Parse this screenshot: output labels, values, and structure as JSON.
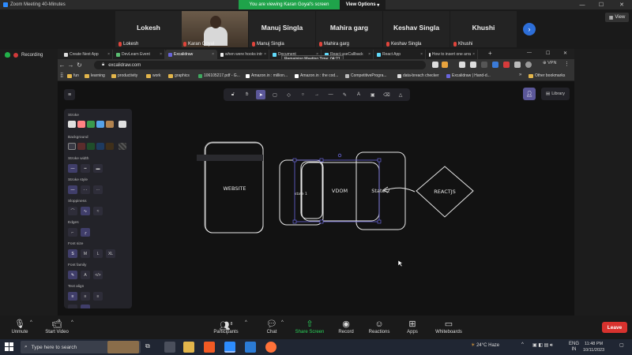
{
  "window": {
    "title": "Zoom Meeting 40-Minutes"
  },
  "share_banner": {
    "message": "You are viewing Karan Goyal's screen",
    "options_label": "View Options"
  },
  "participants": [
    {
      "name": "Lokesh",
      "foot": "Lokesh"
    },
    {
      "name": "Karan Goyal",
      "foot": "Karan Goyal",
      "video": true
    },
    {
      "name": "Manuj Singla",
      "foot": "Manuj Singla"
    },
    {
      "name": "Mahira garg",
      "foot": "Mahira garg"
    },
    {
      "name": "Keshav Singla",
      "foot": "Keshav Singla"
    },
    {
      "name": "Khushi",
      "foot": "Khushi"
    }
  ],
  "view_label": "View",
  "recording_label": "Recording",
  "browser": {
    "tabs": [
      "Create Next App",
      "DevLearn Event",
      "Excalidraw",
      "when were hooks intr",
      "Document",
      "React.useCallback",
      "React App",
      "How to insert one arra"
    ],
    "tooltip": "Remaining Meeting Time: 04:21",
    "url": "excalidraw.com",
    "vpn": "VPN",
    "bookmarks": [
      "fun",
      "learning",
      "productivity",
      "work",
      "graphics",
      "106105217.pdf - G...",
      "Amazon.in : million...",
      "Amazon.in : the cod...",
      "CompetitiveProgra...",
      "data-breach checker",
      "Excalidraw | Hand-d..."
    ],
    "other_bookmarks": "Other bookmarks"
  },
  "excalidraw": {
    "library_label": "Library",
    "panel": {
      "stroke": "Stroke",
      "background": "Background",
      "stroke_width": "Stroke width",
      "stroke_style": "Stroke style",
      "sloppiness": "Sloppiness",
      "edges": "Edges",
      "font_size": "Font size",
      "font_family": "Font family",
      "text_align": "Text align",
      "font_sizes": [
        "S",
        "M",
        "L",
        "XL"
      ]
    },
    "stroke_colors": [
      "#e0e0e0",
      "#ff8383",
      "#3a994c",
      "#56a2e8",
      "#b2834f"
    ],
    "background_colors": [
      "#3a3a45",
      "#5b2c2c",
      "#1f4d2a",
      "#1e3a5f",
      "#3f2f1a"
    ],
    "shapes": {
      "website": "WEBSITE",
      "state1": "state 1",
      "vdom": "VDOM",
      "state2": "State 2",
      "reactjs": "REACTJS"
    }
  },
  "controls": {
    "unmute": "Unmute",
    "start_video": "Start Video",
    "participants": "Participants",
    "participants_count": "8",
    "chat": "Chat",
    "share_screen": "Share Screen",
    "record": "Record",
    "reactions": "Reactions",
    "apps": "Apps",
    "whiteboards": "Whiteboards",
    "leave": "Leave"
  },
  "taskbar": {
    "search_placeholder": "Type here to search",
    "weather": "24°C  Haze",
    "lang": "ENG",
    "region": "IN",
    "time": "11:48 PM",
    "date": "10/11/2023"
  }
}
